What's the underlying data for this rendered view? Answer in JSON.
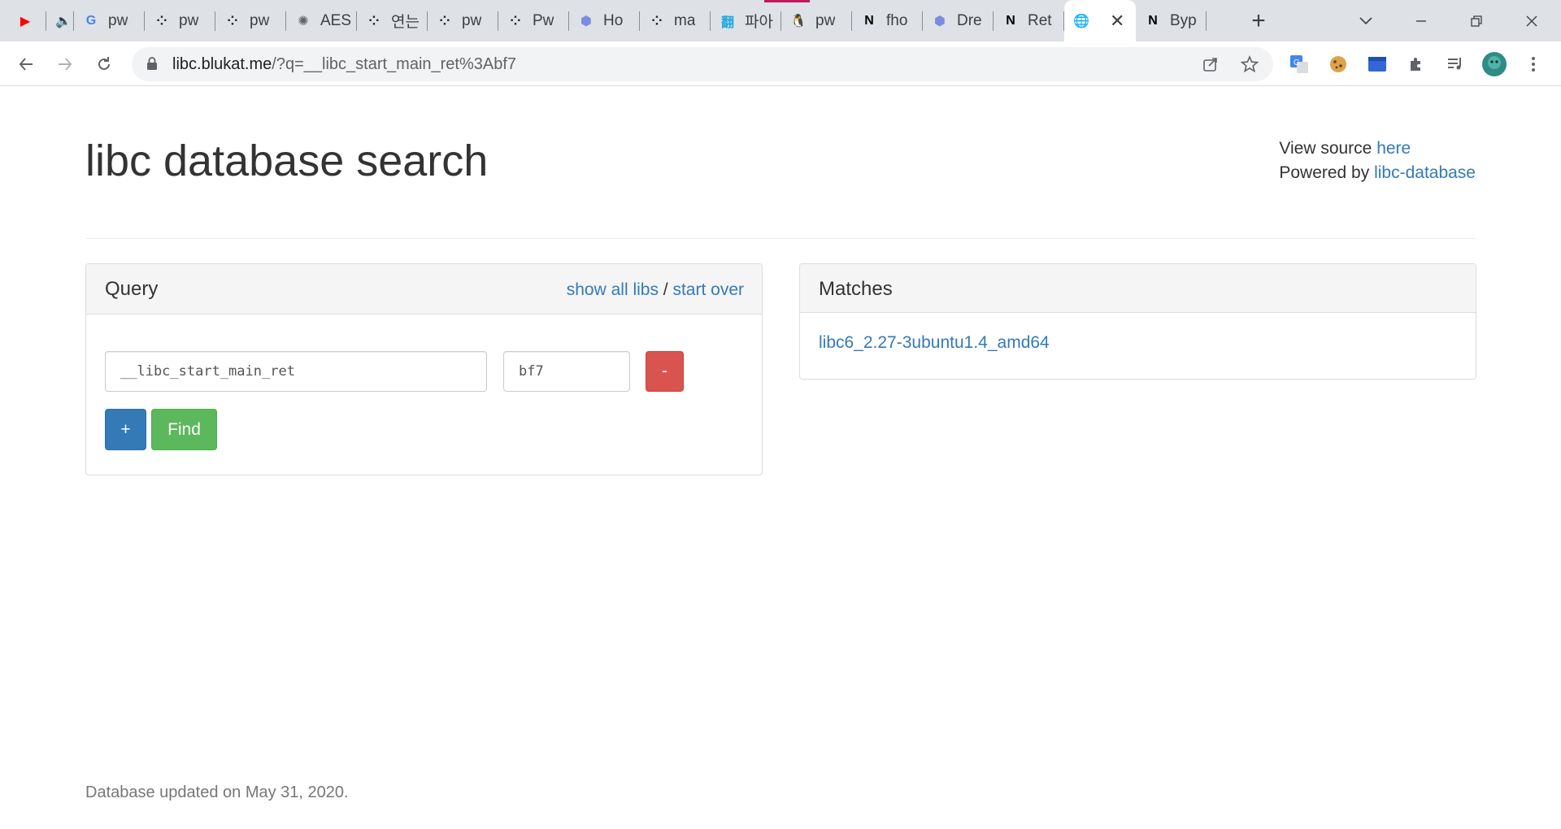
{
  "browser": {
    "tabs": [
      {
        "title": "",
        "icon": "youtube-icon",
        "color": "#ff0000",
        "glyph": "▶"
      },
      {
        "title": "",
        "icon": "speaker-icon",
        "color": "#3c4043",
        "glyph": "🔈"
      },
      {
        "title": "pw",
        "icon": "google-icon",
        "color": "#4285f4",
        "glyph": "G"
      },
      {
        "title": "pw",
        "icon": "dots-icon",
        "color": "#202124",
        "glyph": "⁘"
      },
      {
        "title": "pw",
        "icon": "dots-icon",
        "color": "#202124",
        "glyph": "⁘"
      },
      {
        "title": "AES",
        "icon": "gear-logo-icon",
        "color": "#5f6368",
        "glyph": "✺"
      },
      {
        "title": "연는",
        "icon": "dots-icon",
        "color": "#202124",
        "glyph": "⁘"
      },
      {
        "title": "pw",
        "icon": "dots-icon",
        "color": "#202124",
        "glyph": "⁘"
      },
      {
        "title": "Pw",
        "icon": "dots-icon",
        "color": "#202124",
        "glyph": "⁘"
      },
      {
        "title": "Ho",
        "icon": "hexagon-icon",
        "color": "#7b8cde",
        "glyph": "⬢"
      },
      {
        "title": "ma",
        "icon": "dots-icon",
        "color": "#202124",
        "glyph": "⁘"
      },
      {
        "title": "파아",
        "icon": "papago-icon",
        "color": "#1ea7e1",
        "glyph": "翻"
      },
      {
        "title": "pw",
        "icon": "linux-icon",
        "color": "#202124",
        "glyph": "🐧"
      },
      {
        "title": "fho",
        "icon": "notion-icon",
        "color": "#000000",
        "glyph": "N"
      },
      {
        "title": "Dre",
        "icon": "hexagon-icon",
        "color": "#7b8cde",
        "glyph": "⬢"
      },
      {
        "title": "Ret",
        "icon": "notion-icon",
        "color": "#000000",
        "glyph": "N"
      },
      {
        "title": "",
        "icon": "globe-icon",
        "color": "#5f6368",
        "glyph": "🌐",
        "active": true
      },
      {
        "title": "Byp",
        "icon": "notion-icon",
        "color": "#000000",
        "glyph": "N"
      }
    ],
    "url_host": "libc.blukat.me",
    "url_path": "/?q=__libc_start_main_ret%3Abf7"
  },
  "page": {
    "title": "libc database search",
    "view_source_prefix": "View source ",
    "view_source_link": "here",
    "powered_by_prefix": "Powered by ",
    "powered_by_link": "libc-database",
    "footer": "Database updated on May 31, 2020."
  },
  "query": {
    "title": "Query",
    "show_all_libs": "show all libs",
    "separator": " / ",
    "start_over": "start over",
    "symbol_value": "__libc_start_main_ret",
    "address_value": "bf7",
    "remove_label": "-",
    "add_label": "+",
    "find_label": "Find"
  },
  "matches": {
    "title": "Matches",
    "items": [
      "libc6_2.27-3ubuntu1.4_amd64"
    ]
  },
  "colors": {
    "link": "#337ab7",
    "danger": "#d9534f",
    "primary": "#337ab7",
    "success": "#5cb85c"
  }
}
